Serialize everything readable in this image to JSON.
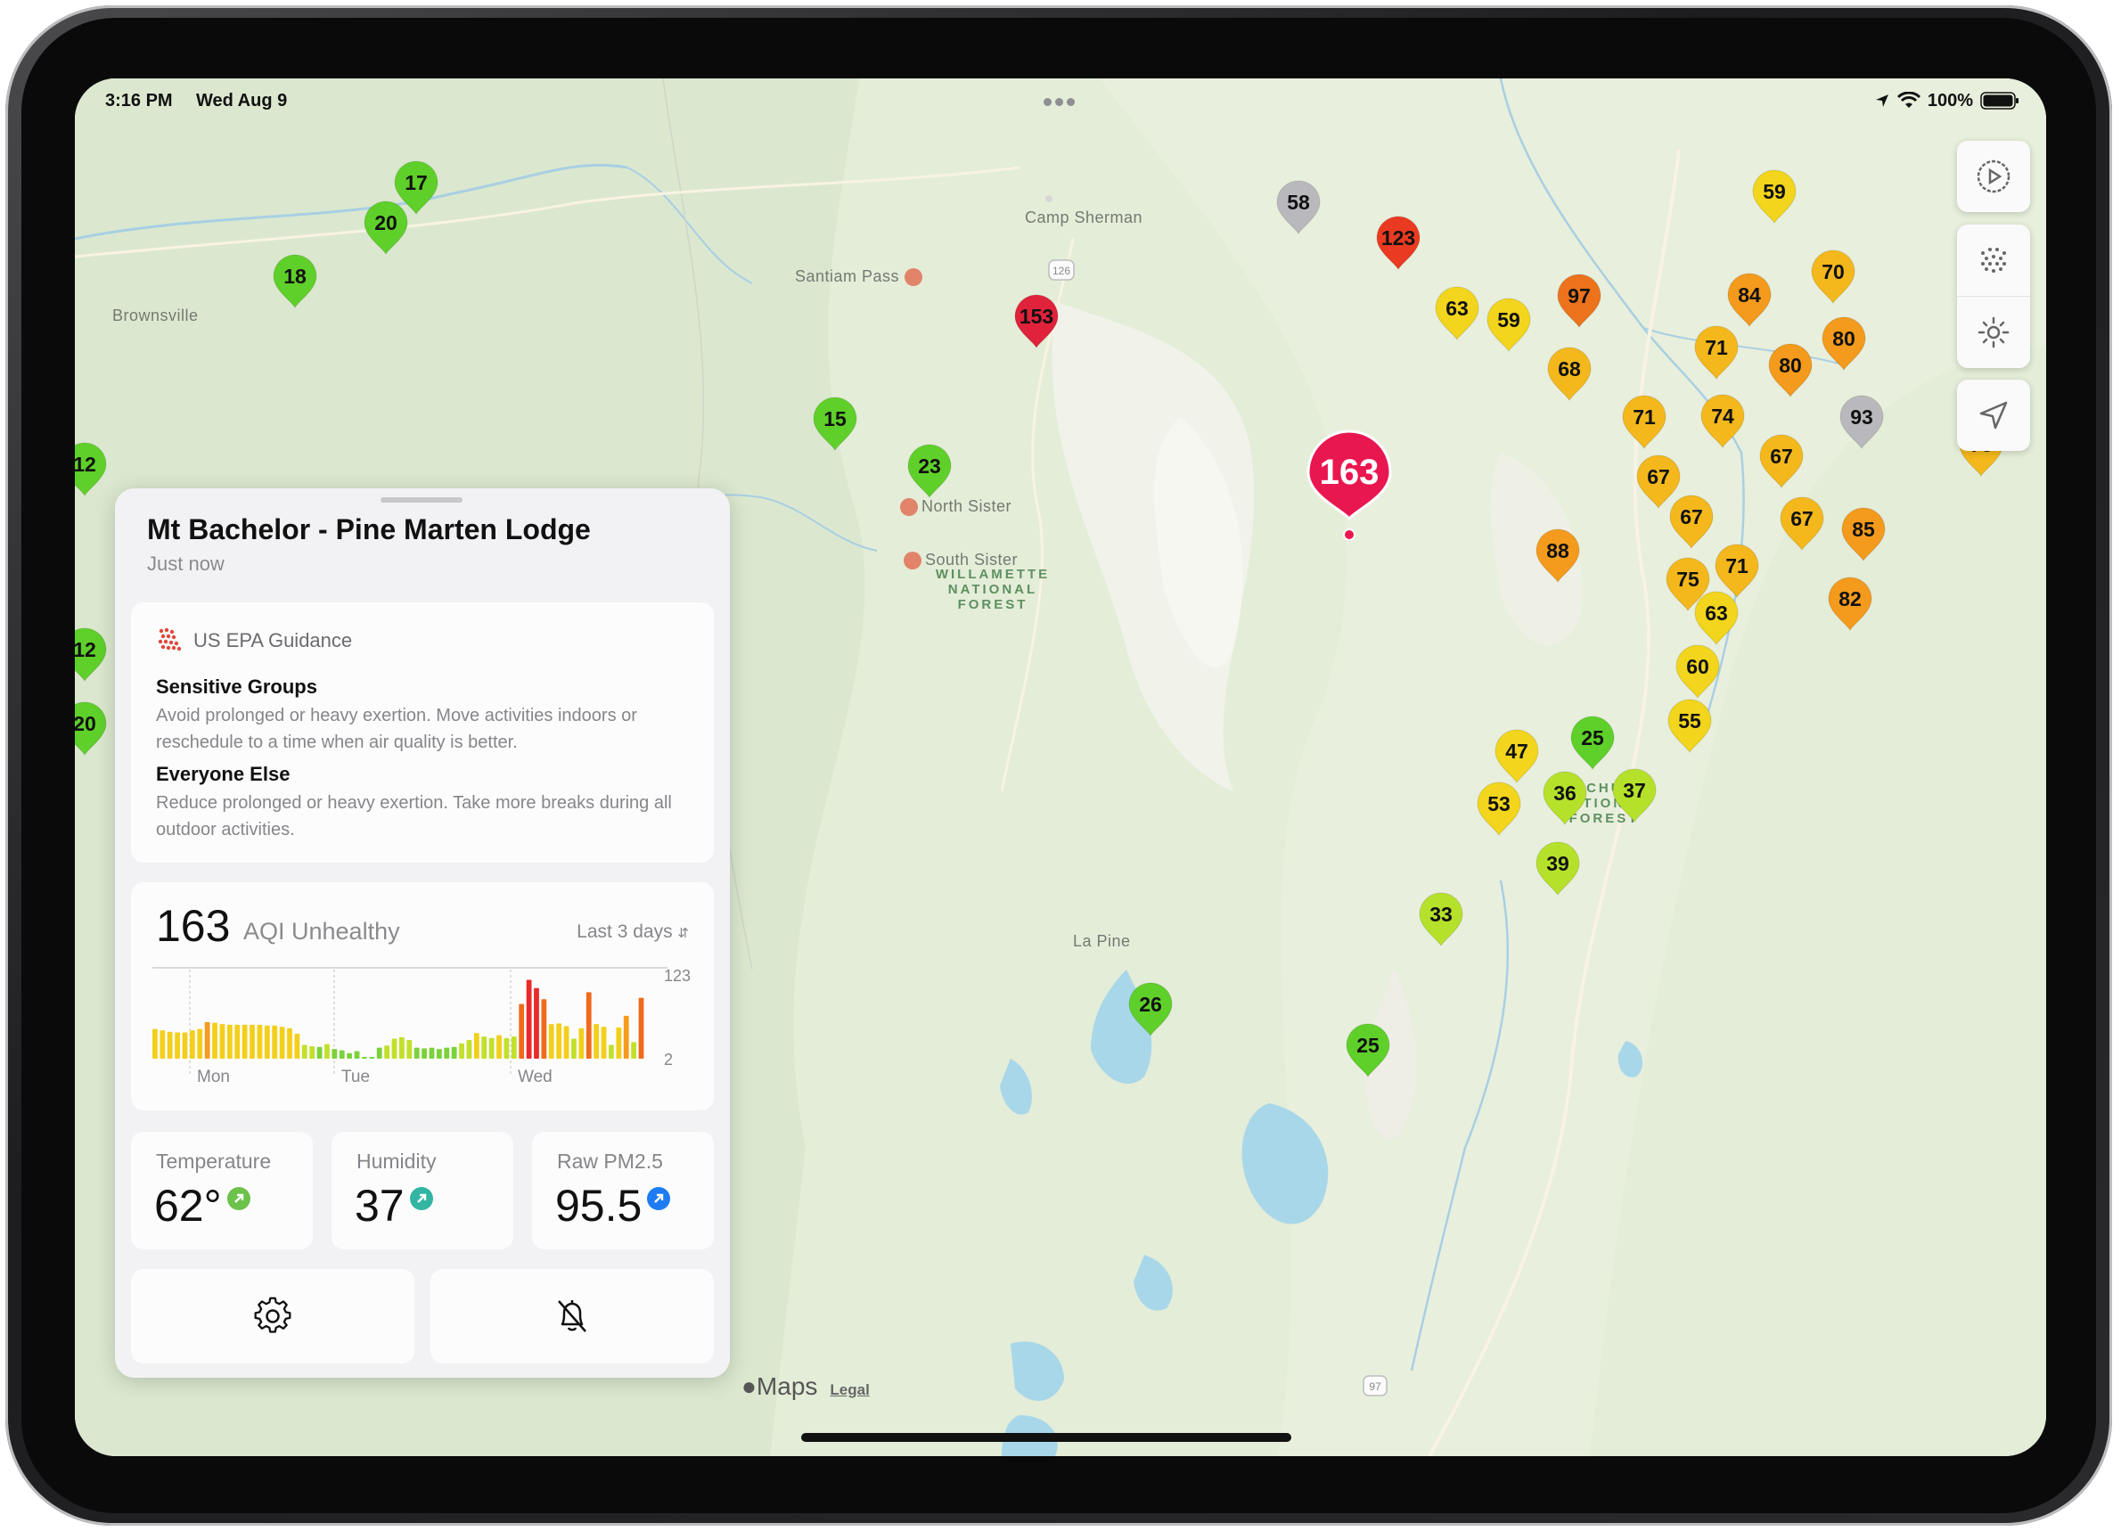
{
  "status_bar": {
    "time": "3:16 PM",
    "date": "Wed Aug 9",
    "battery": "100%"
  },
  "map": {
    "places": [
      {
        "name": "Brownsville"
      },
      {
        "name": "Santiam Pass"
      },
      {
        "name": "Camp Sherman"
      },
      {
        "name": "North Sister"
      },
      {
        "name": "South Sister"
      },
      {
        "name": "La Pine"
      }
    ],
    "forests": [
      {
        "name": "WILLAMETTE NATIONAL FOREST",
        "lines": [
          "WILLAMETTE",
          "NATIONAL",
          "FOREST"
        ]
      },
      {
        "name": "DESCHUTES NATIONAL FOREST",
        "lines": [
          "DESCHUTES",
          "NATIONAL",
          "FOREST"
        ]
      }
    ],
    "highways": [
      "126",
      "97"
    ],
    "attribution": {
      "brand": "Maps",
      "legal": "Legal"
    },
    "selected_sensor": {
      "aqi": "163"
    },
    "sensors": [
      "17",
      "20",
      "18",
      "15",
      "23",
      "153",
      "58",
      "123",
      "59",
      "97",
      "84",
      "70",
      "63",
      "59",
      "68",
      "71",
      "80",
      "80",
      "71",
      "74",
      "93",
      "76",
      "67",
      "67",
      "67",
      "67",
      "85",
      "88",
      "75",
      "71",
      "63",
      "82",
      "60",
      "55",
      "47",
      "25",
      "53",
      "36",
      "37",
      "39",
      "33",
      "26",
      "25",
      "12",
      "12",
      "20"
    ]
  },
  "map_controls": [
    "time-dial-icon",
    "dots-grid-icon",
    "brightness-icon",
    "location-arrow-icon"
  ],
  "panel": {
    "title": "Mt Bachelor - Pine Marten Lodge",
    "subtitle": "Just now",
    "guidance": {
      "source": "US EPA Guidance",
      "groups": [
        {
          "title": "Sensitive Groups",
          "text": "Avoid prolonged or heavy exertion. Move activities indoors or reschedule to a time when air quality is better."
        },
        {
          "title": "Everyone Else",
          "text": "Reduce prolonged or heavy exertion. Take more breaks during all outdoor activities."
        }
      ]
    },
    "aqi": {
      "value": "163",
      "label": "AQI Unhealthy",
      "range_selector": "Last 3 days"
    },
    "metrics": [
      {
        "label": "Temperature",
        "value": "62°",
        "trend": "up",
        "color": "#6cc24a"
      },
      {
        "label": "Humidity",
        "value": "37",
        "trend": "up",
        "color": "#32b5a3"
      },
      {
        "label": "Raw PM2.5",
        "value": "95.5",
        "trend": "up",
        "color": "#1e7cf2"
      }
    ],
    "actions": [
      "settings-icon",
      "notification-off-icon"
    ]
  },
  "chart_data": {
    "type": "bar",
    "title": "",
    "x_labels": [
      "Mon",
      "Tue",
      "Wed"
    ],
    "y_ticks": [
      123,
      2
    ],
    "ylim": [
      2,
      123
    ],
    "values": [
      45,
      43,
      41,
      40,
      40,
      43,
      45,
      55,
      54,
      52,
      51,
      51,
      51,
      51,
      51,
      50,
      50,
      48,
      46,
      38,
      22,
      20,
      19,
      23,
      16,
      14,
      10,
      13,
      2,
      4,
      18,
      21,
      31,
      33,
      29,
      18,
      17,
      18,
      16,
      18,
      19,
      24,
      29,
      39,
      34,
      32,
      36,
      32,
      34,
      81,
      116,
      104,
      88,
      52,
      53,
      49,
      31,
      46,
      98,
      52,
      48,
      22,
      47,
      64,
      26,
      90
    ]
  }
}
